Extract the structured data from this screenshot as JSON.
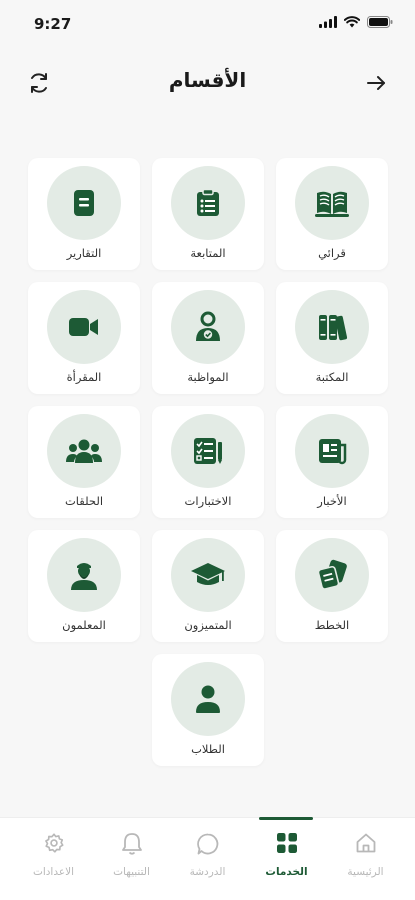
{
  "status": {
    "time": "9:27"
  },
  "header": {
    "title": "الأقسام"
  },
  "cards": [
    {
      "label": "قرائي",
      "icon": "open-book-icon"
    },
    {
      "label": "المتابعة",
      "icon": "clipboard-icon"
    },
    {
      "label": "التقارير",
      "icon": "document-icon"
    },
    {
      "label": "المكتبة",
      "icon": "books-icon"
    },
    {
      "label": "المواظبة",
      "icon": "user-check-icon"
    },
    {
      "label": "المقرأة",
      "icon": "video-camera-icon"
    },
    {
      "label": "الأخبار",
      "icon": "newspaper-icon"
    },
    {
      "label": "الاختبارات",
      "icon": "checklist-icon"
    },
    {
      "label": "الحلقات",
      "icon": "group-icon"
    },
    {
      "label": "الخطط",
      "icon": "plans-icon"
    },
    {
      "label": "المتميزون",
      "icon": "graduation-cap-icon"
    },
    {
      "label": "المعلمون",
      "icon": "teacher-icon"
    },
    {
      "label": "الطلاب",
      "icon": "student-icon"
    }
  ],
  "bottom_nav": {
    "items": [
      {
        "label": "الرئيسية",
        "icon": "home-icon"
      },
      {
        "label": "الخدمات",
        "icon": "grid-icon",
        "active": true
      },
      {
        "label": "الدردشة",
        "icon": "chat-icon"
      },
      {
        "label": "التنبيهات",
        "icon": "bell-icon"
      },
      {
        "label": "الاعدادات",
        "icon": "settings-icon"
      }
    ]
  },
  "colors": {
    "accent": "#1d5a35",
    "circle": "#e3ebe5",
    "background": "#f7f7f7"
  }
}
